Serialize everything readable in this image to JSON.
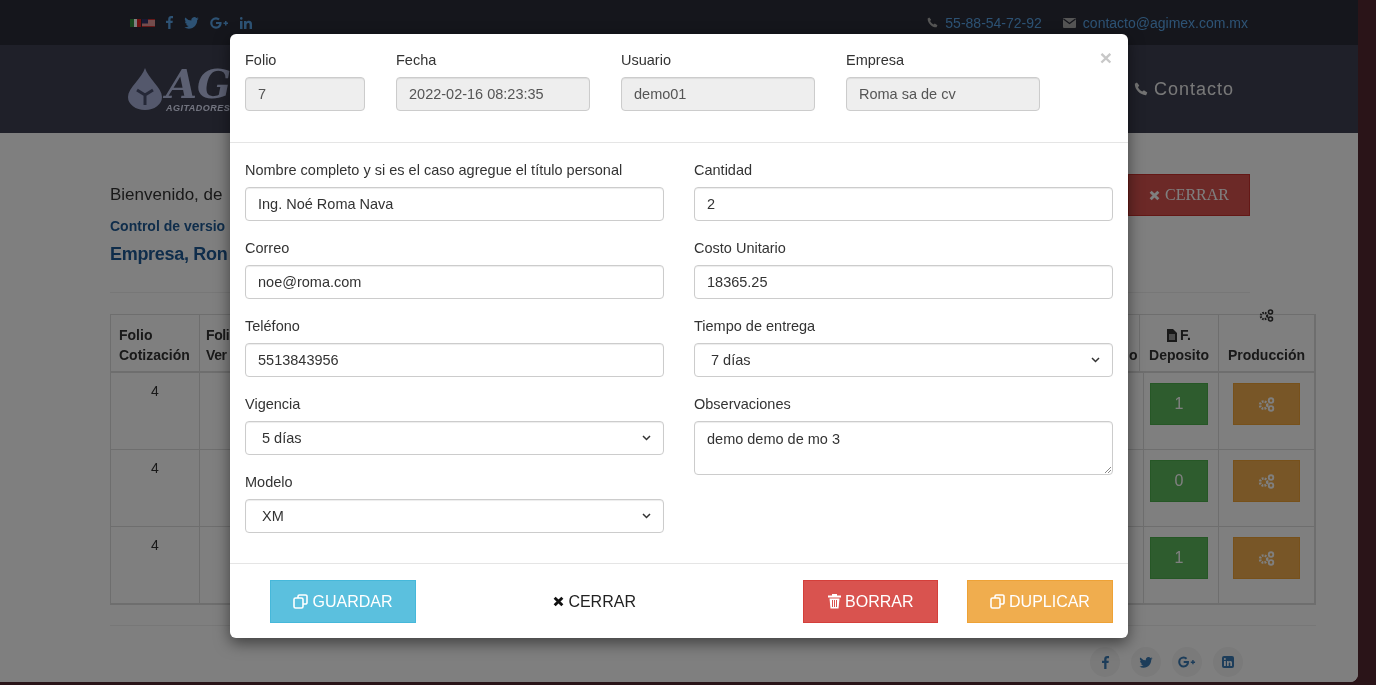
{
  "top_bar": {
    "phone": "55-88-54-72-92",
    "email": "contacto@agimex.com.mx"
  },
  "navbar": {
    "logo_text": "AG",
    "logo_subtitle": "AGITADORES",
    "menu": [
      {
        "label": "Contacto"
      }
    ]
  },
  "page": {
    "greeting": "Bienvenido, de",
    "version_link": "Control de versio",
    "company_heading": "Empresa, Ron",
    "close_button": "CERRAR"
  },
  "table": {
    "columns": [
      {
        "lines": [
          "Folio",
          "Cotización"
        ]
      },
      {
        "lines": [
          "Foli",
          "Ver"
        ]
      },
      {
        "lines": [
          "o"
        ]
      },
      {
        "lines": [
          "F.",
          "Deposito"
        ]
      },
      {
        "lines": [
          "Producción"
        ]
      }
    ],
    "rows": [
      {
        "folio": "4",
        "deposito": "1"
      },
      {
        "folio": "4",
        "deposito": "0"
      },
      {
        "folio": "4",
        "deposito": "1"
      }
    ]
  },
  "modal": {
    "header_fields": [
      {
        "label": "Folio",
        "value": "7"
      },
      {
        "label": "Fecha",
        "value": "2022-02-16 08:23:35"
      },
      {
        "label": "Usuario",
        "value": "demo01"
      },
      {
        "label": "Empresa",
        "value": "Roma sa de cv"
      }
    ],
    "left_fields": [
      {
        "label": "Nombre completo y si es el caso agregue el título personal",
        "value": "Ing. Noé Roma Nava",
        "kind": "input"
      },
      {
        "label": "Correo",
        "value": "noe@roma.com",
        "kind": "input"
      },
      {
        "label": "Teléfono",
        "value": "5513843956",
        "kind": "input"
      },
      {
        "label": "Vigencia",
        "value": "5 días",
        "kind": "select"
      },
      {
        "label": "Modelo",
        "value": "XM",
        "kind": "select"
      }
    ],
    "right_fields": [
      {
        "label": "Cantidad",
        "value": "2",
        "kind": "input"
      },
      {
        "label": "Costo Unitario",
        "value": "18365.25",
        "kind": "input"
      },
      {
        "label": "Tiempo de entrega",
        "value": "7 días",
        "kind": "select"
      },
      {
        "label": "Observaciones",
        "value": "demo demo de mo 3",
        "kind": "textarea"
      }
    ],
    "close_symbol": "×",
    "buttons": [
      {
        "label": "GUARDAR",
        "kind": "info"
      },
      {
        "label": "CERRAR",
        "kind": "plain"
      },
      {
        "label": "BORRAR",
        "kind": "danger"
      },
      {
        "label": "DUPLICAR",
        "kind": "warning"
      }
    ]
  }
}
